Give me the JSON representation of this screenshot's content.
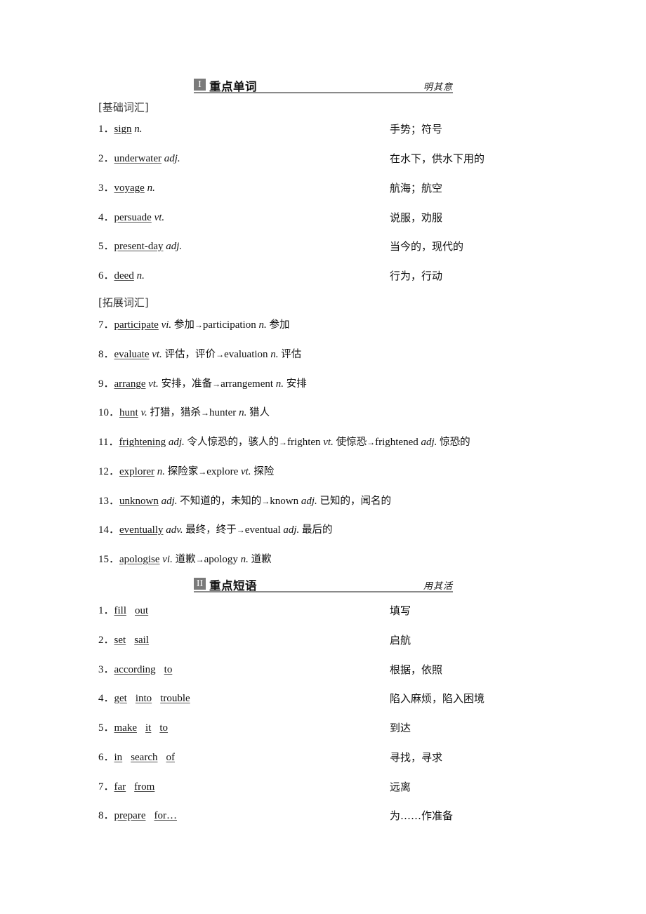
{
  "section1": {
    "badge": "I",
    "title": "重点单词",
    "tag": "明其意",
    "basic_label": "[基础词汇]",
    "basic": [
      {
        "num": "1．",
        "word": "sign",
        "pos": "n.",
        "meaning": "手势；符号"
      },
      {
        "num": "2．",
        "word": "underwater",
        "pos": "adj.",
        "meaning": "在水下，供水下用的"
      },
      {
        "num": "3．",
        "word": "voyage",
        "pos": "n.",
        "meaning": "航海；航空"
      },
      {
        "num": "4．",
        "word": "persuade",
        "pos": "vt.",
        "meaning": "说服，劝服"
      },
      {
        "num": "5．",
        "word": "present-day",
        "pos": "adj.",
        "meaning": "当今的，现代的"
      },
      {
        "num": "6．",
        "word": "deed",
        "pos": "n.",
        "meaning": "行为，行动"
      }
    ],
    "extended_label": "[拓展词汇]",
    "extended": [
      {
        "num": "7．",
        "word": "participate",
        "pos": "vi.",
        "meaning": "参加",
        "derived": [
          {
            "word": "participation",
            "pos": "n.",
            "meaning": "参加"
          }
        ]
      },
      {
        "num": "8．",
        "word": "evaluate",
        "pos": "vt.",
        "meaning": "评估，评价",
        "derived": [
          {
            "word": "evaluation",
            "pos": "n.",
            "meaning": "评估"
          }
        ]
      },
      {
        "num": "9．",
        "word": "arrange",
        "pos": "vt.",
        "meaning": "安排，准备",
        "derived": [
          {
            "word": "arrangement",
            "pos": "n.",
            "meaning": "安排"
          }
        ]
      },
      {
        "num": "10．",
        "word": "hunt",
        "pos": "v.",
        "meaning": "打猎，猎杀",
        "derived": [
          {
            "word": "hunter",
            "pos": "n.",
            "meaning": "猎人"
          }
        ]
      },
      {
        "num": "11．",
        "word": "frightening",
        "pos": "adj.",
        "meaning": "令人惊恐的，骇人的",
        "derived": [
          {
            "word": "frighten",
            "pos": "vt.",
            "meaning": "使惊恐"
          },
          {
            "word": "frightened",
            "pos": "adj.",
            "meaning": "惊恐的"
          }
        ]
      },
      {
        "num": "12．",
        "word": "explorer",
        "pos": "n.",
        "meaning": "探险家",
        "derived": [
          {
            "word": "explore",
            "pos": "vt.",
            "meaning": "探险"
          }
        ]
      },
      {
        "num": "13．",
        "word": "unknown",
        "pos": "adj.",
        "meaning": "不知道的，未知的",
        "derived": [
          {
            "word": "known",
            "pos": "adj.",
            "meaning": "已知的，闻名的"
          }
        ]
      },
      {
        "num": "14．",
        "word": "eventually",
        "pos": "adv.",
        "meaning": "最终，终于",
        "derived": [
          {
            "word": "eventual",
            "pos": "adj.",
            "meaning": "最后的"
          }
        ]
      },
      {
        "num": "15．",
        "word": "apologise",
        "pos": "vi.",
        "meaning": "道歉",
        "derived": [
          {
            "word": "apology",
            "pos": "n.",
            "meaning": "道歉"
          }
        ]
      }
    ],
    "arrow": "→"
  },
  "section2": {
    "badge": "II",
    "title": "重点短语",
    "tag": "用其活",
    "phrases": [
      {
        "num": "1．",
        "parts": [
          "fill",
          "out"
        ],
        "meaning": "填写"
      },
      {
        "num": "2．",
        "parts": [
          "set",
          "sail"
        ],
        "meaning": "启航"
      },
      {
        "num": "3．",
        "parts": [
          "according",
          "to"
        ],
        "meaning": "根据，依照"
      },
      {
        "num": "4．",
        "parts": [
          "get",
          "into",
          "trouble"
        ],
        "meaning": "陷入麻烦，陷入困境"
      },
      {
        "num": "5．",
        "parts": [
          "make",
          "it",
          "to"
        ],
        "meaning": "到达"
      },
      {
        "num": "6．",
        "parts": [
          "in",
          "search",
          "of"
        ],
        "meaning": "寻找，寻求"
      },
      {
        "num": "7．",
        "parts": [
          "far",
          "from"
        ],
        "meaning": "远离"
      },
      {
        "num": "8．",
        "parts": [
          "prepare",
          "for…"
        ],
        "meaning": "为……作准备"
      }
    ]
  }
}
